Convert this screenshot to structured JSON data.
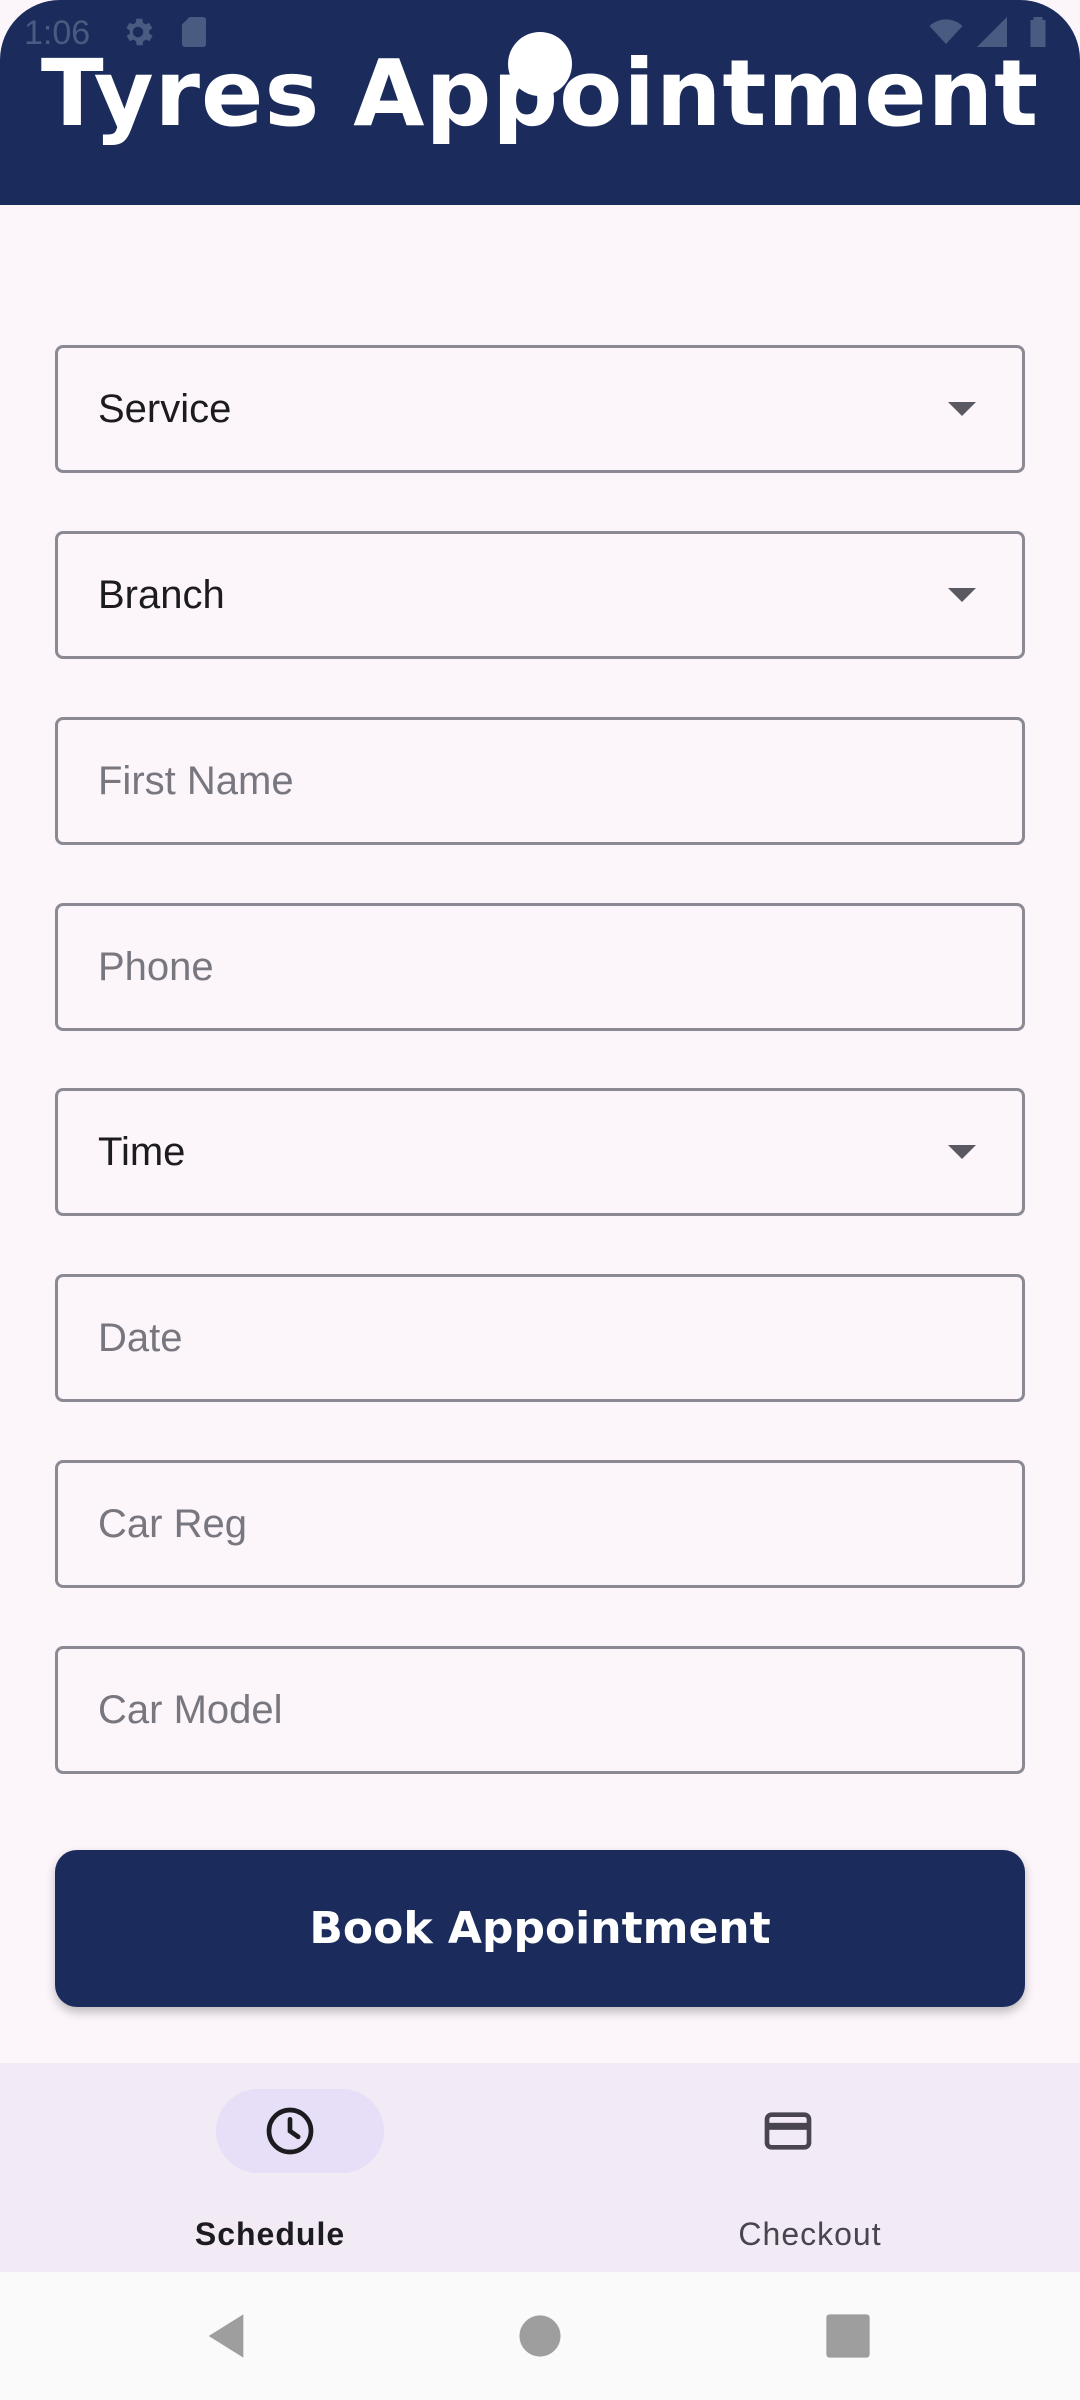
{
  "status_bar": {
    "time": "1:06",
    "left_icons": [
      "gear-icon",
      "sd-card-icon"
    ],
    "right_icons": [
      "wifi-icon",
      "signal-icon",
      "battery-icon"
    ]
  },
  "header": {
    "title": "Tyres Appointment",
    "background_color": "#1b2c5c"
  },
  "form": {
    "service": {
      "value": "Service",
      "icon": "dropdown-arrow-icon"
    },
    "branch": {
      "value": "Branch",
      "icon": "dropdown-arrow-icon"
    },
    "first_name": {
      "placeholder": "First Name"
    },
    "phone": {
      "placeholder": "Phone"
    },
    "time": {
      "value": "Time",
      "icon": "dropdown-arrow-icon"
    },
    "date": {
      "placeholder": "Date"
    },
    "car_reg": {
      "placeholder": "Car Reg"
    },
    "car_model": {
      "placeholder": "Car Model"
    },
    "submit_label": "Book Appointment"
  },
  "bottom_nav": {
    "items": [
      {
        "label": "Schedule",
        "icon": "clock-icon",
        "selected": true
      },
      {
        "label": "Checkout",
        "icon": "credit-card-icon",
        "selected": false
      }
    ],
    "selected_indicator_color": "#e7def7"
  },
  "system_nav": {
    "buttons": [
      "back-icon",
      "home-icon",
      "recents-icon"
    ]
  }
}
